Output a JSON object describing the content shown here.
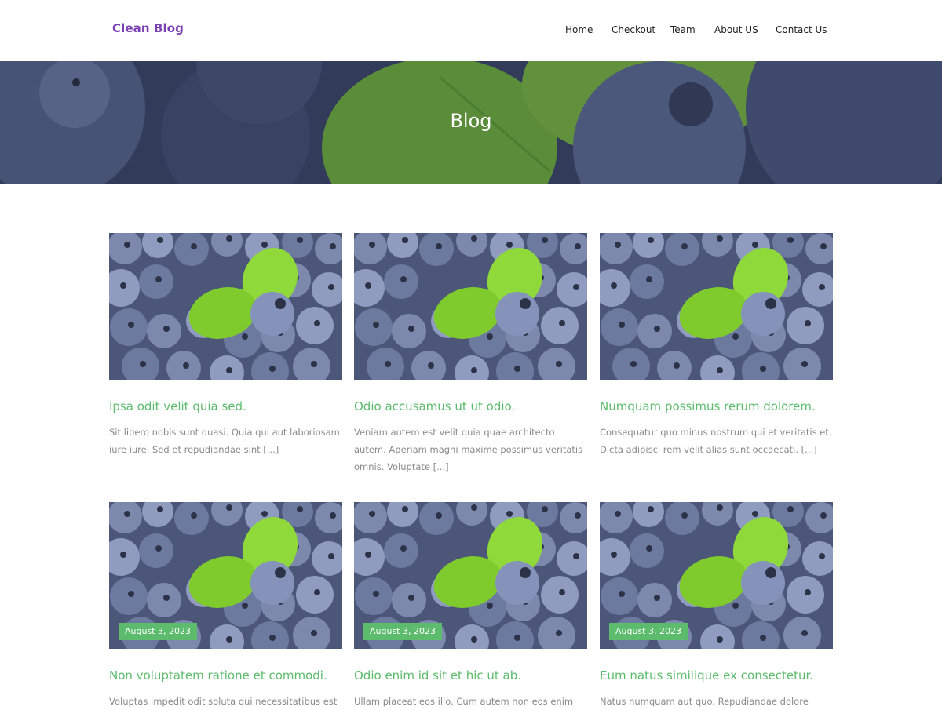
{
  "site": {
    "brand": "Clean Blog"
  },
  "nav": {
    "items": [
      {
        "label": "Home"
      },
      {
        "label": "Checkout"
      },
      {
        "label": "Team"
      },
      {
        "label": "About US"
      },
      {
        "label": "Contact Us"
      }
    ]
  },
  "hero": {
    "title": "Blog"
  },
  "colors": {
    "brand": "#7b3fb5",
    "accent": "#5cbb6d",
    "muted_text": "#8a8a8a"
  },
  "posts": [
    {
      "title": "Ipsa odit velit quia sed.",
      "excerpt": "Sit libero nobis sunt quasi. Quia qui aut laboriosam iure iure. Sed et repudiandae sint [...]"
    },
    {
      "title": "Odio accusamus ut ut odio.",
      "excerpt": "Veniam autem est velit quia quae architecto autem. Aperiam magni maxime possimus veritatis omnis. Voluptate [...]"
    },
    {
      "title": "Numquam possimus rerum dolorem.",
      "excerpt": "Consequatur quo minus nostrum qui et veritatis et. Dicta adipisci rem velit alias sunt occaecati. [...]"
    },
    {
      "title": "Non voluptatem ratione et commodi.",
      "date": "August 3, 2023",
      "excerpt": "Voluptas impedit odit soluta qui necessitatibus est"
    },
    {
      "title": "Odio enim id sit et hic ut ab.",
      "date": "August 3, 2023",
      "excerpt": "Ullam placeat eos illo. Cum autem non eos enim"
    },
    {
      "title": "Eum natus similique ex consectetur.",
      "date": "August 3, 2023",
      "excerpt": "Natus numquam aut quo. Repudiandae dolore"
    }
  ]
}
